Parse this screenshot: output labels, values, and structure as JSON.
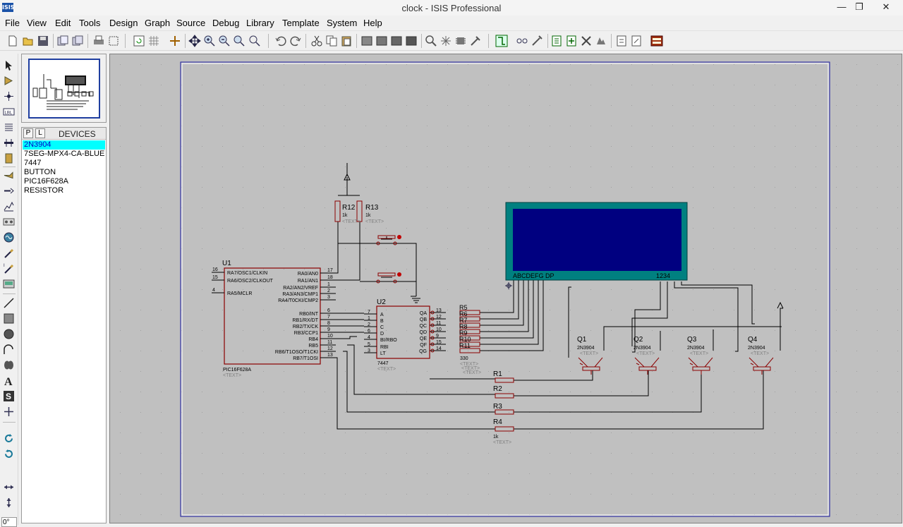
{
  "window": {
    "title": "clock - ISIS Professional",
    "app_icon_label": "ISIS",
    "controls": [
      "—",
      "❐",
      "✕"
    ]
  },
  "menu": [
    "File",
    "View",
    "Edit",
    "Tools",
    "Design",
    "Graph",
    "Source",
    "Debug",
    "Library",
    "Template",
    "System",
    "Help"
  ],
  "device_panel": {
    "tab_p": "P",
    "tab_l": "L",
    "title": "DEVICES",
    "selected_index": 0,
    "items": [
      "2N3904",
      "7SEG-MPX4-CA-BLUE",
      "7447",
      "BUTTON",
      "PIC16F628A",
      "RESISTOR"
    ]
  },
  "rotation": "0°",
  "schematic": {
    "text_placeholder": "<TEXT>",
    "u1": {
      "ref": "U1",
      "part": "PIC16F628A",
      "pins_left": [
        {
          "num": "16",
          "name": "RA7/OSC1/CLKIN"
        },
        {
          "num": "15",
          "name": "RA6/OSC2/CLKOUT"
        },
        {
          "num": "4",
          "name": "RA5/MCLR"
        }
      ],
      "pins_right": [
        {
          "num": "17",
          "name": "RA0/AN0"
        },
        {
          "num": "18",
          "name": "RA1/AN1"
        },
        {
          "num": "1",
          "name": "RA2/AN2/VREF"
        },
        {
          "num": "2",
          "name": "RA3/AN3/CMP1"
        },
        {
          "num": "3",
          "name": "RA4/T0CKI/CMP2"
        },
        {
          "num": "6",
          "name": "RB0/INT"
        },
        {
          "num": "7",
          "name": "RB1/RX/DT"
        },
        {
          "num": "8",
          "name": "RB2/TX/CK"
        },
        {
          "num": "9",
          "name": "RB3/CCP1"
        },
        {
          "num": "10",
          "name": "RB4"
        },
        {
          "num": "11",
          "name": "RB5"
        },
        {
          "num": "12",
          "name": "RB6/T1OSO/T1CKI"
        },
        {
          "num": "13",
          "name": "RB7/T1OSI"
        }
      ]
    },
    "u2": {
      "ref": "U2",
      "part": "7447",
      "pins_left": [
        {
          "num": "7",
          "name": "A"
        },
        {
          "num": "1",
          "name": "B"
        },
        {
          "num": "2",
          "name": "C"
        },
        {
          "num": "6",
          "name": "D"
        },
        {
          "num": "4",
          "name": "BI/RBO"
        },
        {
          "num": "5",
          "name": "RBI"
        },
        {
          "num": "3",
          "name": "LT"
        }
      ],
      "pins_right": [
        {
          "num": "13",
          "name": "QA"
        },
        {
          "num": "12",
          "name": "QB"
        },
        {
          "num": "11",
          "name": "QC"
        },
        {
          "num": "10",
          "name": "QD"
        },
        {
          "num": "9",
          "name": "QE"
        },
        {
          "num": "15",
          "name": "QF"
        },
        {
          "num": "14",
          "name": "QG"
        }
      ]
    },
    "seg_resistors": [
      "R5",
      "R6",
      "R7",
      "R8",
      "R9",
      "R10",
      "R11"
    ],
    "seg_resistor_value": "330",
    "pullups": [
      {
        "ref": "R12",
        "value": "1k"
      },
      {
        "ref": "R13",
        "value": "1k"
      }
    ],
    "display": {
      "seg_label": "ABCDEFG  DP",
      "digit_label": "1234",
      "screen_color": "#000080",
      "frame_color": "#008080"
    },
    "transistors": [
      {
        "ref": "Q1",
        "part": "2N3904"
      },
      {
        "ref": "Q2",
        "part": "2N3904"
      },
      {
        "ref": "Q3",
        "part": "2N3904"
      },
      {
        "ref": "Q4",
        "part": "2N3904"
      }
    ],
    "base_resistors": [
      {
        "ref": "R1"
      },
      {
        "ref": "R2"
      },
      {
        "ref": "R3"
      },
      {
        "ref": "R4",
        "value": "1k"
      }
    ],
    "colors": {
      "component": "#8b0000",
      "wire": "#000000",
      "pin_label": "#000000",
      "text_grey": "#808080",
      "sheet": "#c0c0c0"
    }
  }
}
